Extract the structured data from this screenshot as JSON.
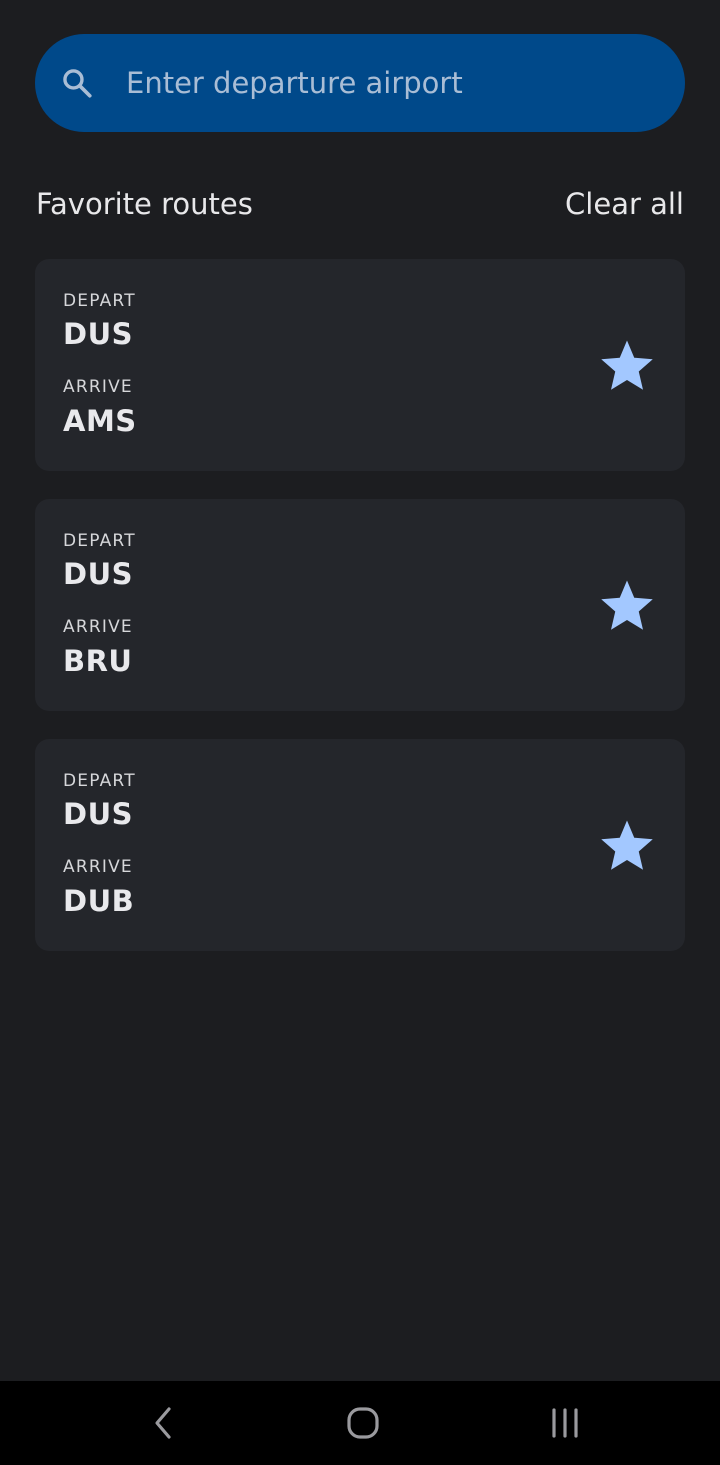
{
  "search": {
    "placeholder": "Enter departure airport",
    "value": ""
  },
  "favorites": {
    "title": "Favorite routes",
    "clear_label": "Clear all",
    "routes": [
      {
        "depart_label": "DEPART",
        "depart": "DUS",
        "arrive_label": "ARRIVE",
        "arrive": "AMS",
        "favorited": true
      },
      {
        "depart_label": "DEPART",
        "depart": "DUS",
        "arrive_label": "ARRIVE",
        "arrive": "BRU",
        "favorited": true
      },
      {
        "depart_label": "DEPART",
        "depart": "DUS",
        "arrive_label": "ARRIVE",
        "arrive": "DUB",
        "favorited": true
      }
    ]
  },
  "icons": {
    "search": "search-icon",
    "favorite": "star-icon",
    "nav_back": "back-chevron-icon",
    "nav_home": "home-icon",
    "nav_recents": "recent-apps-icon"
  },
  "colors": {
    "background": "#1c1d20",
    "search_bar": "#00498a",
    "card": "#24262b",
    "star": "#a3c8ff",
    "nav_bar": "#000000"
  }
}
